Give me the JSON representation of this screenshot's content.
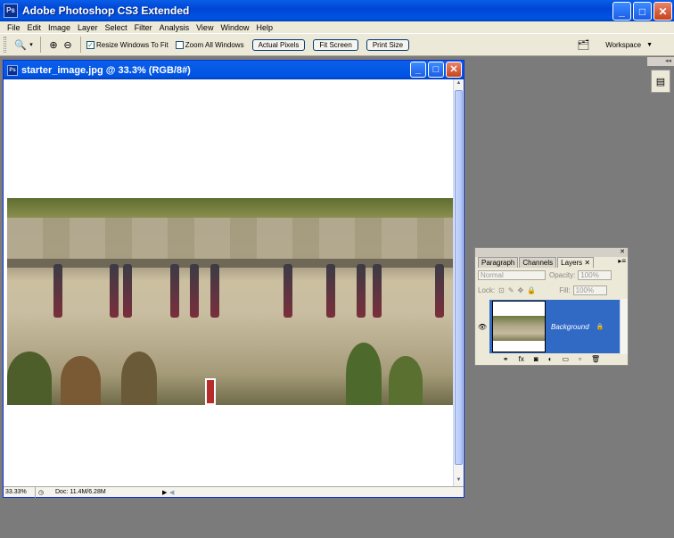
{
  "app": {
    "title": "Adobe Photoshop CS3 Extended",
    "icon_text": "Ps"
  },
  "menu": [
    "File",
    "Edit",
    "Image",
    "Layer",
    "Select",
    "Filter",
    "Analysis",
    "View",
    "Window",
    "Help"
  ],
  "options": {
    "resize_windows": {
      "label": "Resize Windows To Fit",
      "checked": true
    },
    "zoom_all": {
      "label": "Zoom All Windows",
      "checked": false
    },
    "buttons": [
      "Actual Pixels",
      "Fit Screen",
      "Print Size"
    ],
    "workspace": "Workspace"
  },
  "document": {
    "title": "starter_image.jpg @ 33.3% (RGB/8#)",
    "zoom": "33.33%",
    "doc_info": "Doc: 11.4M/6.28M"
  },
  "layers_panel": {
    "tabs": [
      "Paragraph",
      "Channels",
      "Layers"
    ],
    "active_tab": "Layers",
    "blend_mode": "Normal",
    "opacity_label": "Opacity:",
    "opacity_value": "100%",
    "lock_label": "Lock:",
    "fill_label": "Fill:",
    "fill_value": "100%",
    "layer_name": "Background"
  },
  "colors": {
    "xp_blue": "#0054e3",
    "selection": "#316ac5",
    "panel_bg": "#ece9d8",
    "workspace_bg": "#7b7b7b"
  }
}
